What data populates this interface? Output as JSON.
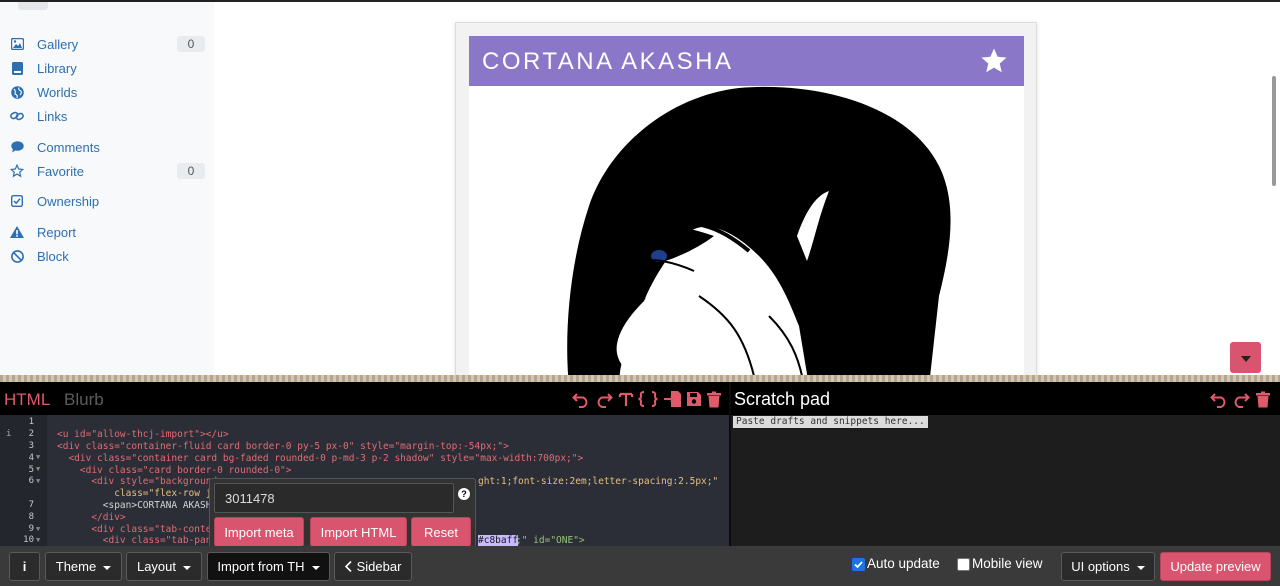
{
  "sidebar": {
    "items": [
      {
        "label": "Gallery",
        "count": "0",
        "icon": "image-icon"
      },
      {
        "label": "Library",
        "icon": "book-icon"
      },
      {
        "label": "Worlds",
        "icon": "globe-icon"
      },
      {
        "label": "Links",
        "icon": "link-icon"
      },
      {
        "label": "Comments",
        "icon": "comment-icon"
      },
      {
        "label": "Favorite",
        "count": "0",
        "icon": "star-outline-icon"
      },
      {
        "label": "Ownership",
        "icon": "checkbox-icon"
      },
      {
        "label": "Report",
        "icon": "warning-icon"
      },
      {
        "label": "Block",
        "icon": "ban-icon"
      }
    ]
  },
  "profile": {
    "name": "CORTANA AKASHA",
    "header_color": "#8b77c7"
  },
  "editor": {
    "tabs": [
      "HTML",
      "Blurb"
    ],
    "active_tab": "HTML",
    "line_numbers": [
      "1",
      "2",
      "3",
      "4",
      "5",
      "6",
      "",
      "7",
      "8",
      "9",
      "10"
    ],
    "code_lines": [
      "",
      "<u id=\"allow-thcj-import\"></u>",
      "<div class=\"container-fluid card border-0 py-5 px-0\" style=\"margin-top:-54px;\">",
      "  <div class=\"container card bg-faded rounded-0 p-md-3 p-2 shadow\" style=\"max-width:700px;\">",
      "    <div class=\"card border-0 rounded-0\">",
      "      <div style=\"background",
      "          class=\"flex-row ju",
      "        <span>CORTANA AKASHA",
      "      </div>",
      "      <div class=\"tab-conten",
      "        <div class=\"tab-pane"
    ],
    "code_line6_tail": "ght:1;font-size:2em;letter-spacing:2.5px;\"",
    "code_line10_highlight": "#c8baff",
    "code_line10_tail": ";\" id=\"ONE\">"
  },
  "scratch": {
    "title": "Scratch pad",
    "placeholder": "Paste drafts and snippets here..."
  },
  "import_popup": {
    "input_value": "3011478",
    "help": "?",
    "buttons": [
      "Import meta",
      "Import HTML",
      "Reset"
    ]
  },
  "bottombar": {
    "info": "i",
    "theme": "Theme",
    "layout": "Layout",
    "import": "Import from TH",
    "sidebar": "Sidebar",
    "auto_update": "Auto update",
    "auto_update_checked": true,
    "mobile_view": "Mobile view",
    "mobile_view_checked": false,
    "ui_options": "UI options",
    "update_preview": "Update preview"
  },
  "colors": {
    "accent": "#d9546f",
    "link": "#2e6fb0",
    "editor_accent": "#e05a6a"
  }
}
